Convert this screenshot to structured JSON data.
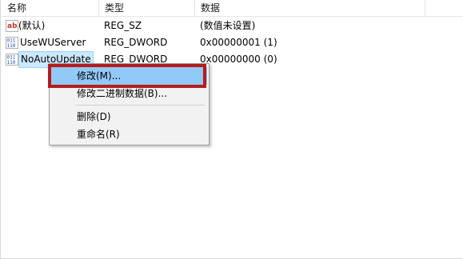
{
  "headers": {
    "name": "名称",
    "type": "类型",
    "data": "数据"
  },
  "rows": [
    {
      "icon": "string-value-icon",
      "name": "(默认)",
      "type": "REG_SZ",
      "data": "(数值未设置)"
    },
    {
      "icon": "dword-value-icon",
      "name": "UseWUServer",
      "type": "REG_DWORD",
      "data": "0x00000001 (1)"
    },
    {
      "icon": "dword-value-icon",
      "name": "NoAutoUpdate",
      "type": "REG_DWORD",
      "data": "0x00000000 (0)"
    }
  ],
  "context_menu": {
    "items": [
      "修改(M)...",
      "修改二进制数据(B)...",
      "删除(D)",
      "重命名(R)"
    ]
  },
  "colors": {
    "selection": "#cce8ff",
    "menu_highlight": "#91c9f7",
    "annotation_box": "#b51c1c"
  }
}
